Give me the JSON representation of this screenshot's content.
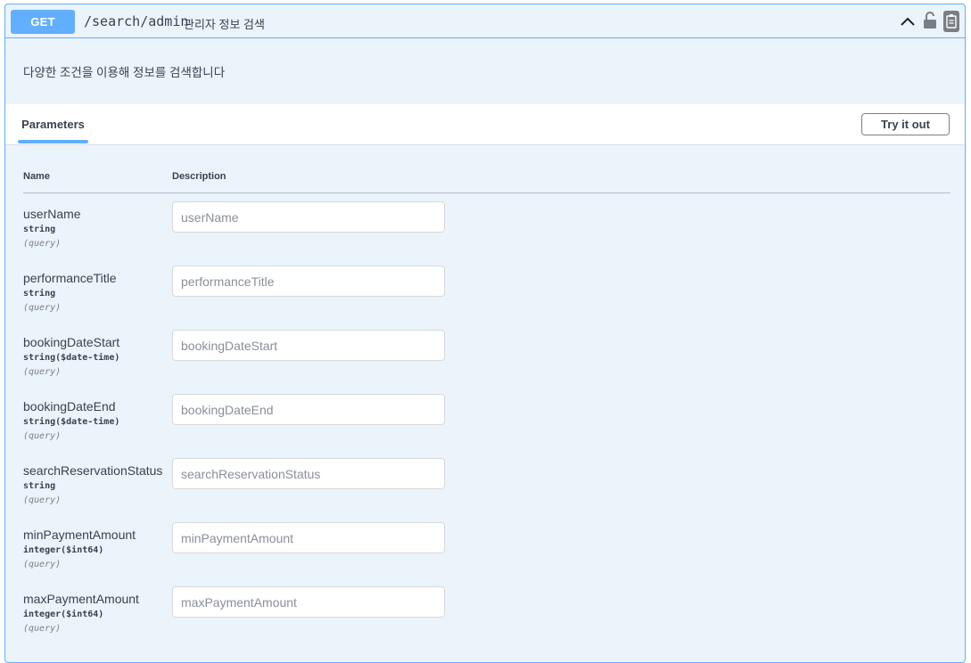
{
  "operation": {
    "method": "GET",
    "path": "/search/admin",
    "summary": "관리자 정보 검색",
    "description": "다양한 조건을 이용해 정보를 검색합니다",
    "icons": [
      "chevron-up-icon",
      "unlock-icon",
      "copy-icon"
    ]
  },
  "parameters_section": {
    "tab_label": "Parameters",
    "try_button_label": "Try it out",
    "col_name": "Name",
    "col_description": "Description",
    "accent_color": "#61affe"
  },
  "params": [
    {
      "name": "userName",
      "type": "string",
      "in": "(query)",
      "placeholder": "userName"
    },
    {
      "name": "performanceTitle",
      "type": "string",
      "in": "(query)",
      "placeholder": "performanceTitle"
    },
    {
      "name": "bookingDateStart",
      "type": "string($date-time)",
      "in": "(query)",
      "placeholder": "bookingDateStart"
    },
    {
      "name": "bookingDateEnd",
      "type": "string($date-time)",
      "in": "(query)",
      "placeholder": "bookingDateEnd"
    },
    {
      "name": "searchReservationStatus",
      "type": "string",
      "in": "(query)",
      "placeholder": "searchReservationStatus"
    },
    {
      "name": "minPaymentAmount",
      "type": "integer($int64)",
      "in": "(query)",
      "placeholder": "minPaymentAmount"
    },
    {
      "name": "maxPaymentAmount",
      "type": "integer($int64)",
      "in": "(query)",
      "placeholder": "maxPaymentAmount"
    }
  ]
}
